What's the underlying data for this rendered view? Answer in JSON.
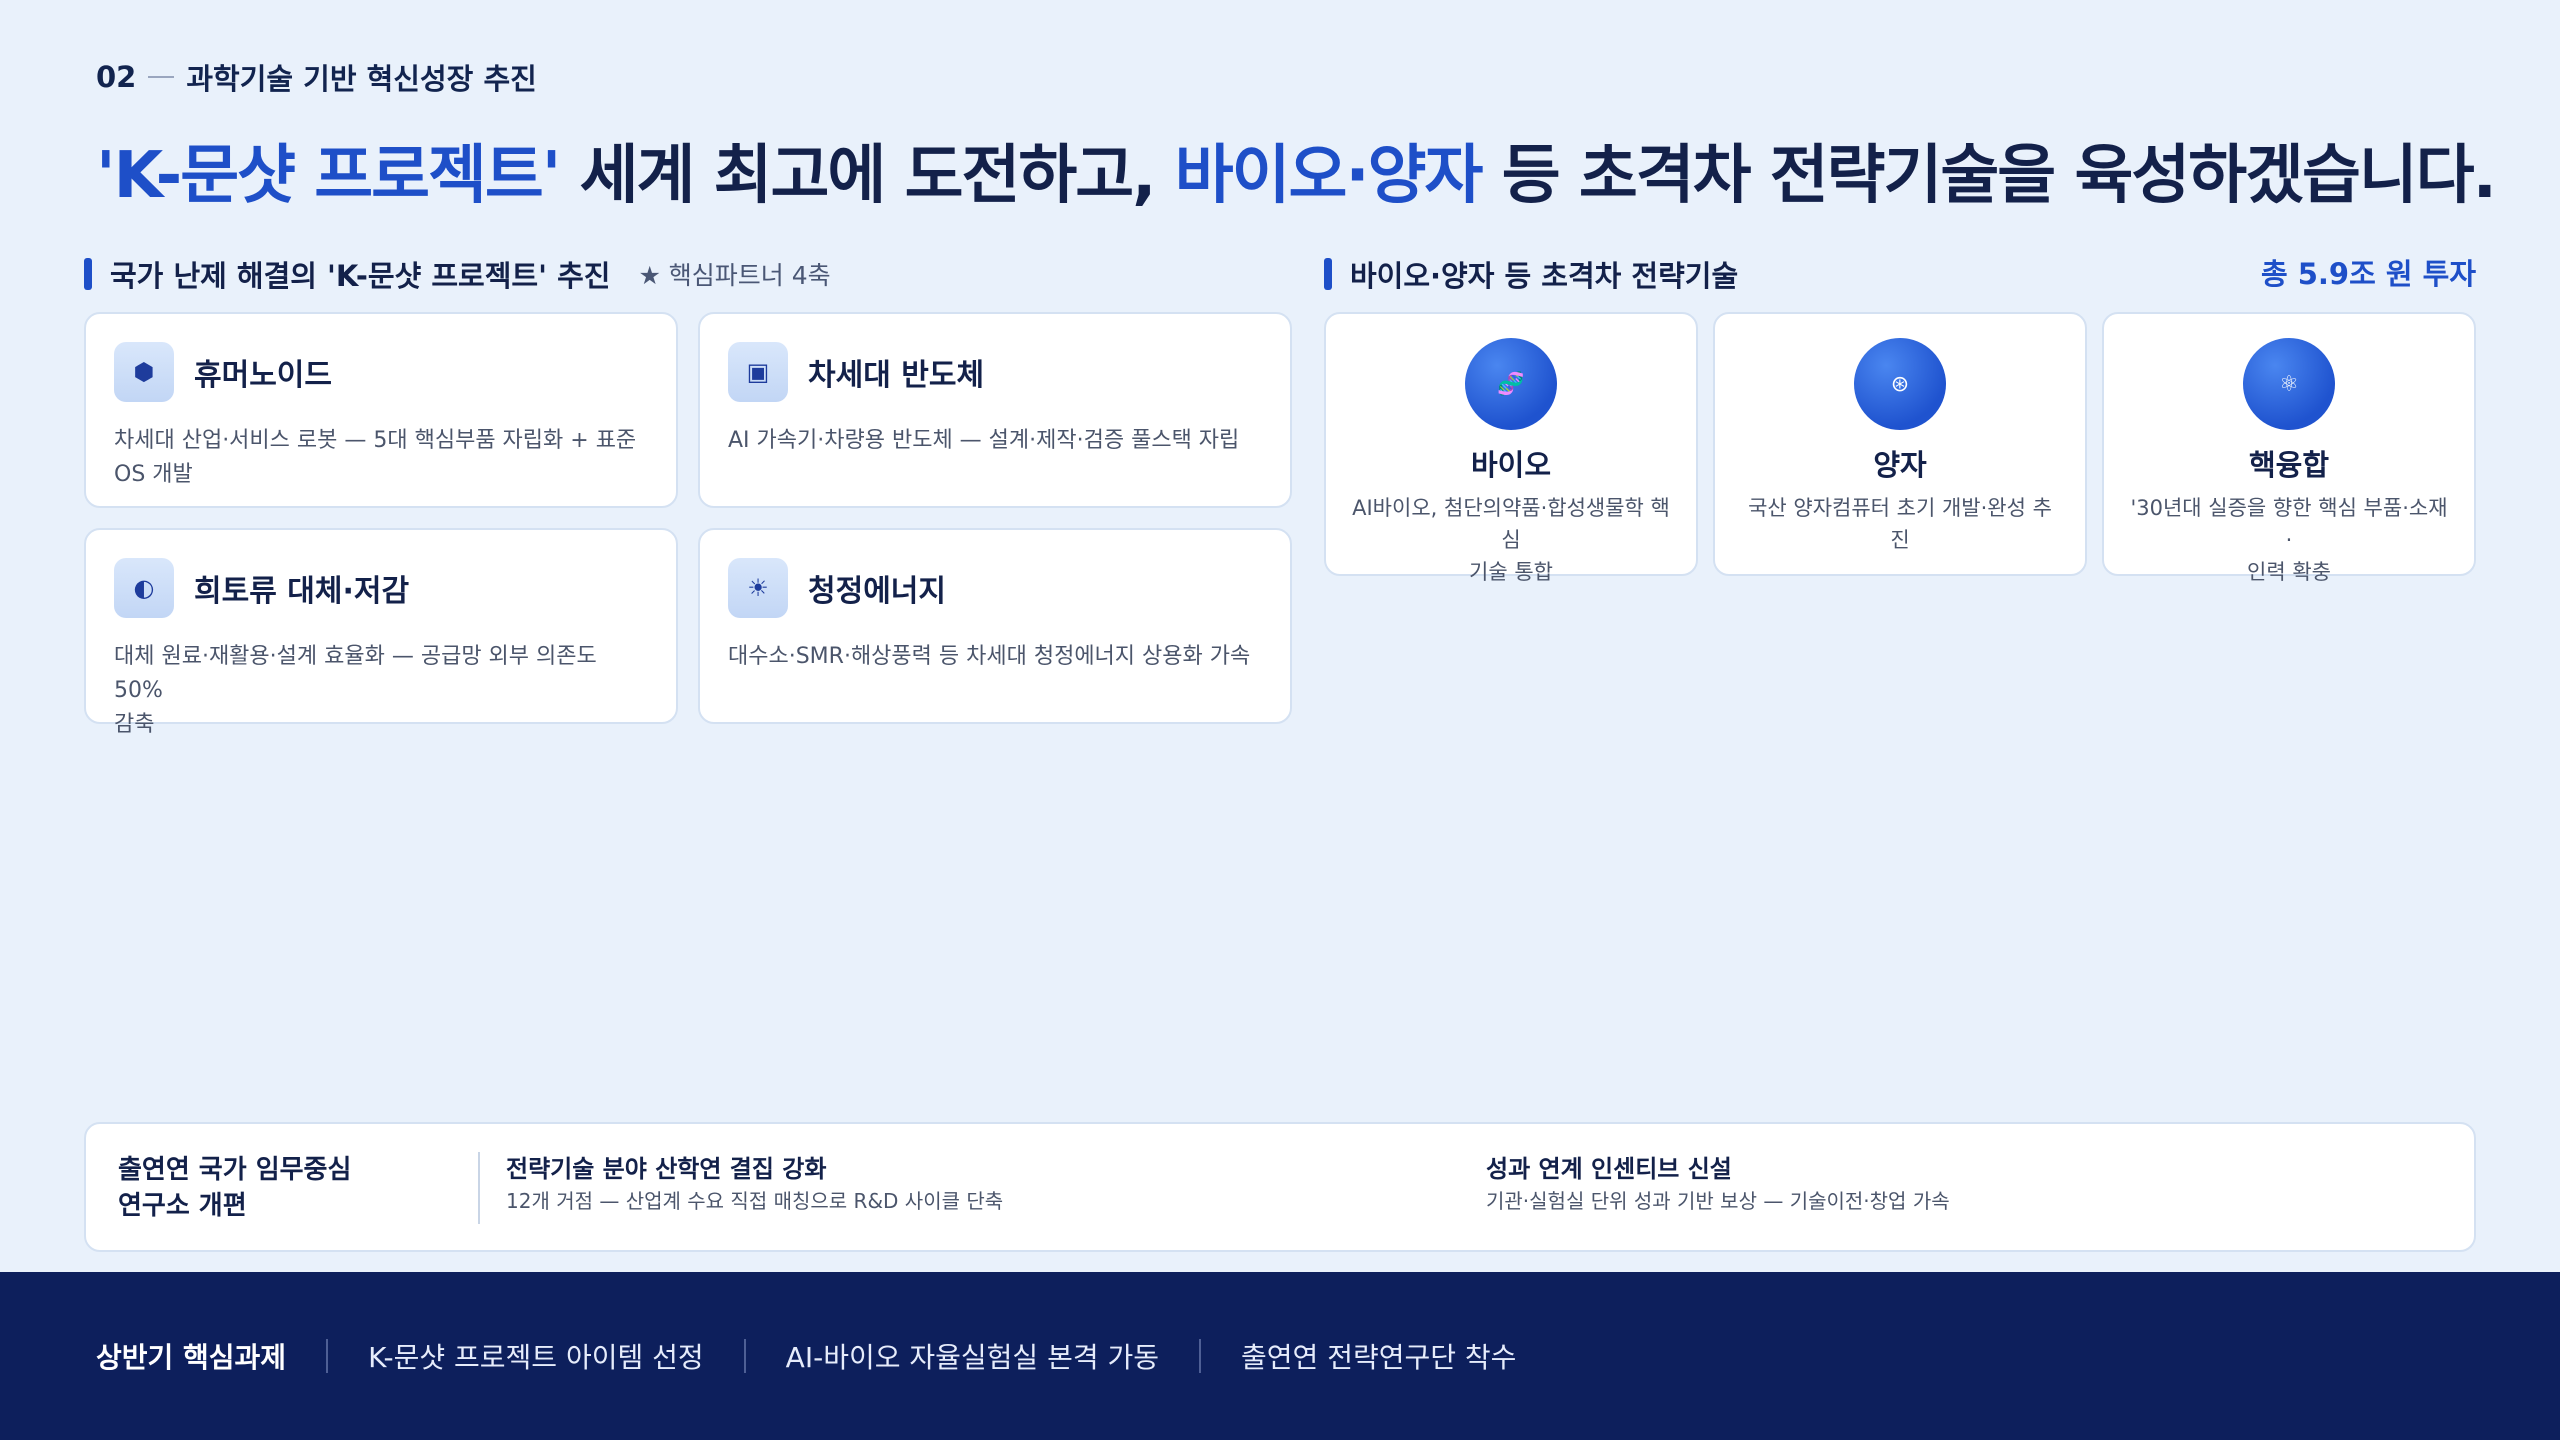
{
  "eyebrow": {
    "number": "02",
    "text": "과학기술 기반 혁신성장 추진"
  },
  "headline": {
    "part1": "'K-문샷 프로젝트'",
    "part2": " 세계 최고에 도전하고, ",
    "part3": "바이오·양자",
    "part4": " 등 초격차 전략기술을 육성하겠습니다."
  },
  "left_section": {
    "title": "국가 난제 해결의 'K-문샷 프로젝트' 추진",
    "sub": "★ 핵심파트너 4축"
  },
  "projects": [
    {
      "icon": "hexagon-icon",
      "glyph": "⬢",
      "title": "휴머노이드",
      "desc_line1": "차세대 산업·서비스 로봇 — 5대 핵심부품 자립화 + 표준",
      "desc_line2": "OS 개발"
    },
    {
      "icon": "chip-icon",
      "glyph": "▣",
      "title": "차세대 반도체",
      "desc_line1": "AI 가속기·차량용 반도체 — 설계·제작·검증 풀스택 자립",
      "desc_line2": ""
    },
    {
      "icon": "half-circle-icon",
      "glyph": "◐",
      "title": "희토류 대체·저감",
      "desc_line1": "대체 원료·재활용·설계 효율화 — 공급망 외부 의존도 50%",
      "desc_line2": "감축"
    },
    {
      "icon": "sun-icon",
      "glyph": "☀",
      "title": "청정에너지",
      "desc_line1": "대수소·SMR·해상풍력 등 차세대 청정에너지 상용화 가속",
      "desc_line2": ""
    }
  ],
  "right_section": {
    "title": "바이오·양자 등 초격차 전략기술",
    "investment": "총 5.9조 원 투자"
  },
  "techs": [
    {
      "icon": "dna-icon",
      "glyph": "🧬",
      "title": "바이오",
      "desc_line1": "AI바이오, 첨단의약품·합성생물학 핵심",
      "desc_line2": "기술 통합"
    },
    {
      "icon": "quantum-icon",
      "glyph": "⊛",
      "title": "양자",
      "desc_line1": "국산 양자컴퓨터 초기 개발·완성 추진",
      "desc_line2": ""
    },
    {
      "icon": "atom-icon",
      "glyph": "⚛",
      "title": "핵융합",
      "desc_line1": "'30년대 실증을 향한 핵심 부품·소재·",
      "desc_line2": "인력 확충"
    }
  ],
  "bottom": {
    "left_line1": "출연연 국가 임무중심",
    "left_line2": "연구소 개편",
    "items": [
      {
        "title": "전략기술 분야 산학연 결집 강화",
        "desc": "12개 거점 — 산업계 수요 직접 매칭으로 R&D 사이클 단축"
      },
      {
        "title": "성과 연계 인센티브 신설",
        "desc": "기관·실험실 단위 성과 기반 보상 — 기술이전·창업 가속"
      }
    ]
  },
  "footer": {
    "lead": "상반기 핵심과제",
    "items": [
      "K-문샷 프로젝트 아이템 선정",
      "AI-바이오 자율실험실 본격 가동",
      "출연연 전략연구단 착수"
    ]
  },
  "colors": {
    "accent": "#1e4fc8",
    "navy": "#0d1f5c",
    "background": "#e9f1fb"
  }
}
